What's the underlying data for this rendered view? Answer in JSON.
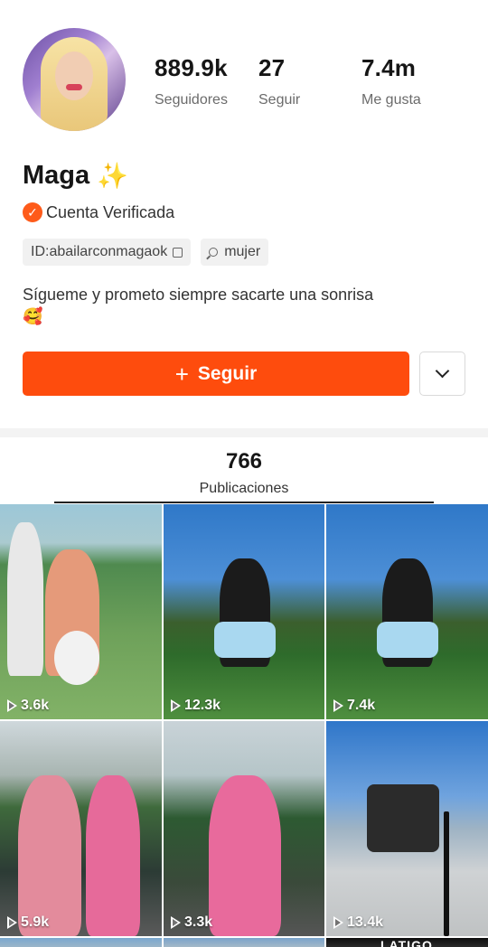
{
  "profile": {
    "stats": {
      "followers": {
        "value": "889.9k",
        "label": "Seguidores"
      },
      "following": {
        "value": "27",
        "label": "Seguir"
      },
      "likes": {
        "value": "7.4m",
        "label": "Me gusta"
      }
    },
    "name": "Maga",
    "name_emoji": "✨",
    "verified_label": "Cuenta Verificada",
    "id_tag": "ID:abailarconmagaok",
    "gender_tag": "mujer",
    "bio": "Sígueme y prometo siempre sacarte una sonrisa",
    "bio_emoji": "🥰"
  },
  "actions": {
    "follow_plus": "+",
    "follow_label": "Seguir"
  },
  "posts": {
    "count": "766",
    "label": "Publicaciones",
    "videos": [
      {
        "views": "3.6k"
      },
      {
        "views": "12.3k"
      },
      {
        "views": "7.4k"
      },
      {
        "views": "5.9k"
      },
      {
        "views": "3.3k"
      },
      {
        "views": "13.4k"
      },
      {
        "views": ""
      },
      {
        "views": ""
      },
      {
        "views": "",
        "banner": "LATIGO"
      }
    ]
  },
  "colors": {
    "accent": "#fe4c0d",
    "verified": "#fe5b1a"
  },
  "icons": {
    "verified": "check-badge-icon",
    "copy": "copy-icon",
    "search": "search-icon",
    "play": "play-icon",
    "dropdown": "chevron-down-icon"
  }
}
